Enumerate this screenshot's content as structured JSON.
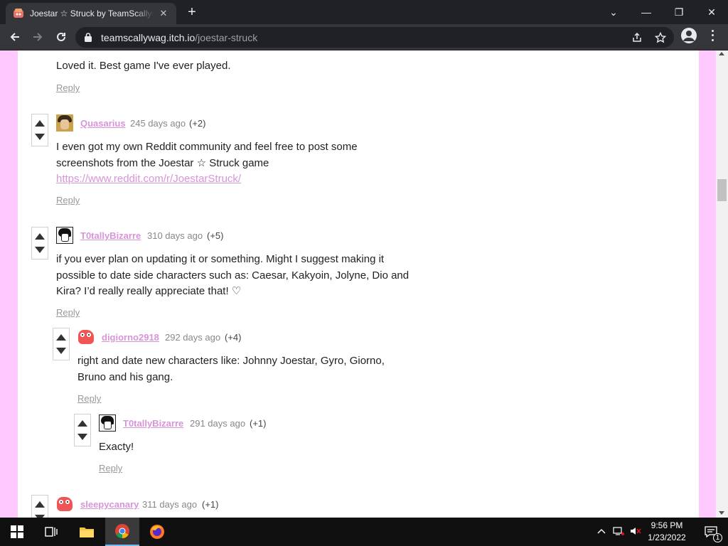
{
  "browser": {
    "tab_title": "Joestar ☆ Struck by TeamScallywag",
    "tab_close": "✕",
    "new_tab": "+",
    "url_domain": "teamscallywag.itch.io",
    "url_path": "/joestar-struck",
    "window_controls": {
      "list": "⌄",
      "minimize": "—",
      "restore": "❐",
      "close": "✕"
    }
  },
  "comments": [
    {
      "text": "Loved it. Best game I've ever played.",
      "reply": "Reply"
    },
    {
      "username": "Quasarius",
      "date": "245 days ago",
      "score": "(+2)",
      "text": "I even got my own Reddit community and feel free to post some screenshots from the Joestar ☆ Struck game ",
      "link": "https://www.reddit.com/r/JoestarStruck/",
      "reply": "Reply"
    },
    {
      "username": "T0tallyBizarre",
      "date": "310 days ago",
      "score": "(+5)",
      "text": "if you ever plan on updating it or something. Might I suggest making it possible to date side characters such as: Caesar, Kakyoin, Jolyne, Dio and Kira? I’d really really appreciate that! ♡",
      "reply": "Reply"
    },
    {
      "username": "digiorno2918",
      "date": "292 days ago",
      "score": "(+4)",
      "text": "right and date new characters like: Johnny Joestar, Gyro, Giorno, Bruno and his gang.",
      "reply": "Reply"
    },
    {
      "username": "T0tallyBizarre",
      "date": "291 days ago",
      "score": "(+1)",
      "text": "Exacty!",
      "reply": "Reply"
    },
    {
      "username": "sleepycanary",
      "date": "311 days ago",
      "score": "(+1)"
    }
  ],
  "taskbar": {
    "time": "9:56 PM",
    "date": "1/23/2022",
    "notification_count": "1"
  },
  "colors": {
    "page_background": "#ffc9ff",
    "username_link": "#d894d8",
    "chrome_dark": "#202124",
    "chrome_toolbar": "#35363a"
  }
}
